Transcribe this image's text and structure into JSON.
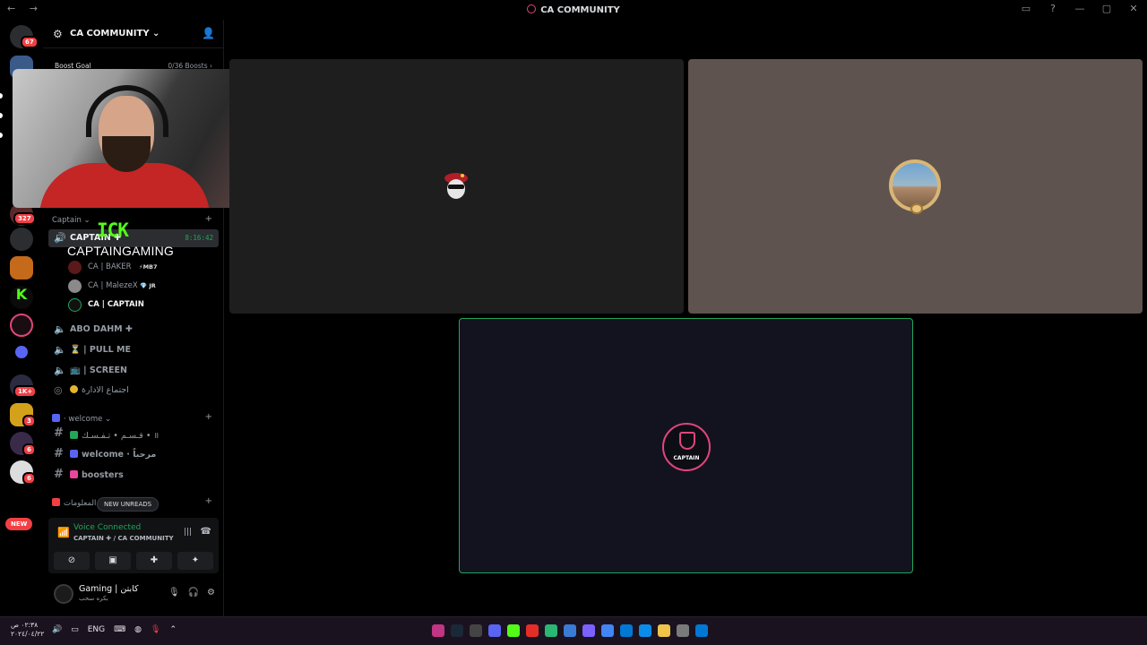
{
  "window": {
    "title": "CA COMMUNITY",
    "nav": "← →",
    "controls": [
      "▭",
      "?",
      "—",
      "▢",
      "✕"
    ]
  },
  "server": {
    "name": "CA COMMUNITY ⌄",
    "boost_label": "Boost Goal",
    "boost_progress": "0/36 Boosts ›"
  },
  "rail": {
    "badges": [
      "67",
      "327",
      "1K+",
      "3",
      "6",
      "6"
    ],
    "new_label": "NEW"
  },
  "categories": {
    "captain": "Captain ⌄",
    "welcome": "· welcome ⌄",
    "info": "المعلومات"
  },
  "voice_channels": [
    {
      "name": "CAPTAIN ✚",
      "time": "8:16:42"
    },
    {
      "name": "ABO DAHM ✚"
    },
    {
      "name": "⏳ | PULL ME"
    },
    {
      "name": "📺 | SCREEN"
    },
    {
      "name": "اجتماع الادارة"
    }
  ],
  "members": [
    {
      "name": "CA | BAKER",
      "tag": "⚡MB7"
    },
    {
      "name": "CA | MalezeX",
      "tag": "💎 JR"
    },
    {
      "name": "CA | CAPTAIN",
      "tag": ""
    }
  ],
  "text_channels": [
    {
      "name": "قـسـم • تـفـسـك  • ॥"
    },
    {
      "name": "welcome · مرحباً"
    },
    {
      "name": "boosters"
    }
  ],
  "unreads_label": "NEW UNREADS",
  "overlay": {
    "kick_text": "ICK",
    "streamer_name": "CAPTAINGAMING"
  },
  "voice_panel": {
    "status": "Voice Connected",
    "location": "CAPTAIN ✚ / CA COMMUNITY"
  },
  "user_panel": {
    "name": "Gaming | كابتن",
    "status": "بكره سحب"
  },
  "taskbar": {
    "time": "٠٢:٣٨ ص",
    "date": "٢٠٢٤/٠٤/٢٢",
    "lang": "ENG"
  },
  "colors": {
    "accent_green": "#23a55a",
    "brand_pink": "#e0457b",
    "kick_green": "#53fc18",
    "danger": "#f23f43"
  }
}
